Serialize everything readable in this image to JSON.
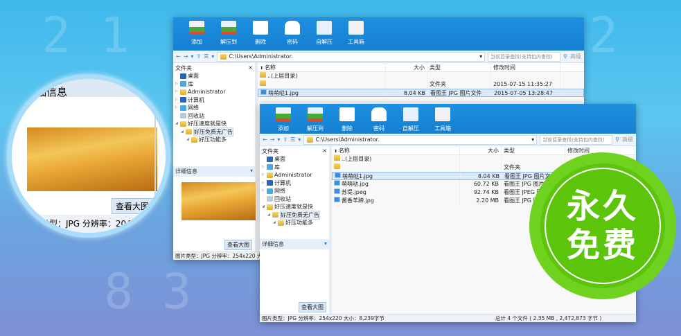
{
  "toolbar": [
    {
      "label": "添加",
      "icon": "add-archive-icon"
    },
    {
      "label": "解压到",
      "icon": "extract-icon"
    },
    {
      "label": "删除",
      "icon": "delete-icon"
    },
    {
      "label": "密码",
      "icon": "lock-icon"
    },
    {
      "label": "自解压",
      "icon": "self-extract-icon"
    },
    {
      "label": "工具箱",
      "icon": "toolbox-icon"
    }
  ],
  "address": {
    "path": "C:\\Users\\Administrator.",
    "search_placeholder": "当前目录查找(支持包内查找)",
    "advanced": "高级"
  },
  "folders_title": "文件夹",
  "close": "×",
  "tree": [
    {
      "label": "桌面",
      "level": 0
    },
    {
      "label": "库",
      "level": 0
    },
    {
      "label": "Administrator",
      "level": 0
    },
    {
      "label": "计算机",
      "level": 0
    },
    {
      "label": "网络",
      "level": 0
    },
    {
      "label": "回收站",
      "level": 0
    },
    {
      "label": "好压速度就是快",
      "level": 0
    },
    {
      "label": "好压免费无广告",
      "level": 1
    },
    {
      "label": "好压功能多",
      "level": 2
    }
  ],
  "detail_title": "详细信息",
  "view_large": "查看大图",
  "columns": [
    "名称",
    "大小",
    "类型",
    "修改时间"
  ],
  "window1": {
    "rows": [
      {
        "name": "..(上层目录)",
        "size": "",
        "type": "",
        "date": "",
        "kind": "folder"
      },
      {
        "name": "",
        "size": "",
        "type": "文件夹",
        "date": "2015-07-15 11:35:27",
        "kind": "folder"
      },
      {
        "name": "萌萌哒1.jpg",
        "size": "8.04 KB",
        "type": "看图王 JPG 图片文件",
        "date": "2015-07-05 13:28:47",
        "kind": "image",
        "selected": true
      }
    ],
    "status_left": "图片类型：JPG 分辨率：254x220 大小"
  },
  "window2": {
    "rows": [
      {
        "name": "..(上层目录)",
        "size": "",
        "type": "",
        "date": "",
        "kind": "folder"
      },
      {
        "name": "",
        "size": "",
        "type": "文件夹",
        "date": "2015-07-15 11:35:27",
        "kind": "folder"
      },
      {
        "name": "萌萌哒1.jpg",
        "size": "8.04 KB",
        "type": "看图王 JPG 图片文件",
        "date": "2015-07-0",
        "kind": "image",
        "selected": true
      },
      {
        "name": "萌萌哒.jpg",
        "size": "60.72 KB",
        "type": "看图王 JPG 图片文件",
        "date": "2015",
        "kind": "image"
      },
      {
        "name": "苏堤.jpeg",
        "size": "92.74 KB",
        "type": "看图王 JPEG 图片文件",
        "date": "",
        "kind": "image"
      },
      {
        "name": "酱香羊蹄.jpg",
        "size": "2.20 MB",
        "type": "看图王 JPG 图片文件",
        "date": "",
        "kind": "image"
      }
    ],
    "status_left": "图片类型：JPG 分辨率：254x220 大小：8,239字节",
    "status_right": "总计 4 个文件 ( 2.35 MB , 2,472,873 字节 )"
  },
  "magnifier": {
    "detail_title": "细信息",
    "view_large": "查看大图",
    "status": "片类型：JPG 分辨率：2048"
  },
  "badge": {
    "line1": "永久",
    "line2": "免费"
  }
}
